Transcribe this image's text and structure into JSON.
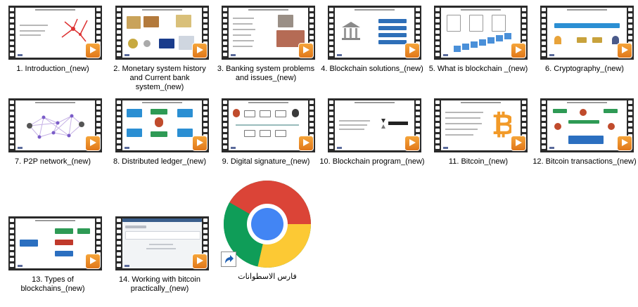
{
  "items": [
    {
      "label": "1. Introduction_(new)"
    },
    {
      "label": "2. Monetary system history and Current bank system_(new)"
    },
    {
      "label": "3. Banking system problems and issues_(new)"
    },
    {
      "label": "4. Blockchain solutions_(new)"
    },
    {
      "label": "5. What is blockchain _(new)"
    },
    {
      "label": "6. Cryptography_(new)"
    },
    {
      "label": "7. P2P network_(new)"
    },
    {
      "label": "8. Distributed ledger_(new)"
    },
    {
      "label": "9. Digital signature_(new)"
    },
    {
      "label": "10. Blockchain program_(new)"
    },
    {
      "label": "11. Bitcoin_(new)"
    },
    {
      "label": "12. Bitcoin transactions_(new)"
    },
    {
      "label": "13. Types of blockchains_(new)"
    },
    {
      "label": "14. Working with bitcoin practically_(new)"
    }
  ],
  "shortcut": {
    "label": "فارس الاسطوانات"
  },
  "icons": {
    "video": "video-file-icon",
    "play": "play-icon",
    "browser": "chrome-icon",
    "shortcut": "shortcut-arrow-icon"
  },
  "colors": {
    "play": "#f39a2b",
    "chrome_red": "#db4437",
    "chrome_green": "#0f9d58",
    "chrome_yellow": "#fcc934",
    "chrome_blue": "#4285f4"
  }
}
